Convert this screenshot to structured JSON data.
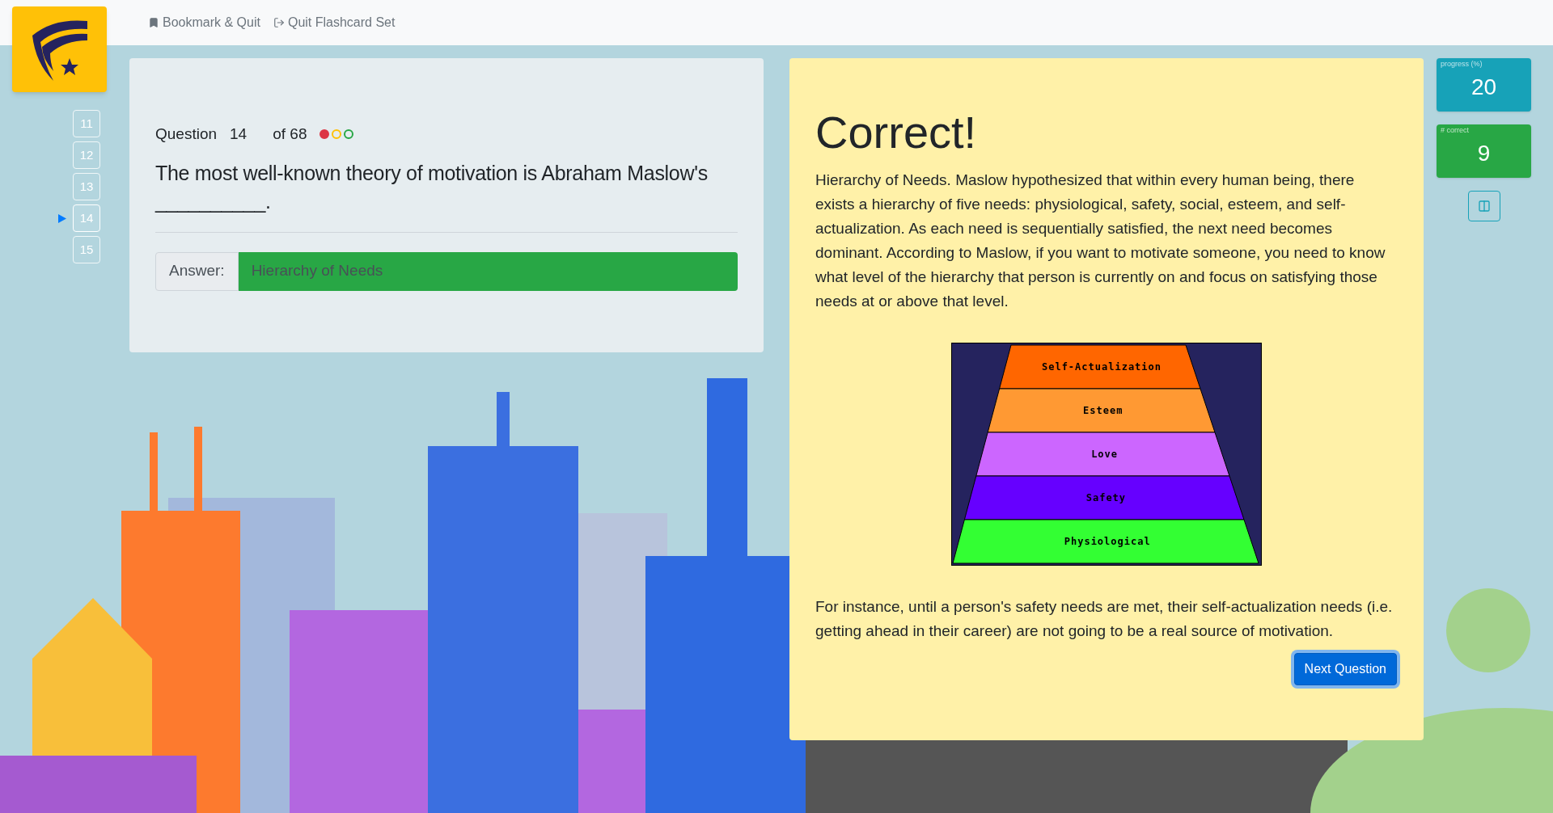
{
  "nav": {
    "links": [
      {
        "kind": "bookmark",
        "label": "Bookmark & Quit"
      },
      {
        "kind": "quit",
        "label": "Quit Flashcard Set"
      }
    ]
  },
  "question_list": [
    {
      "number": "11",
      "selected": false
    },
    {
      "number": "12",
      "selected": false
    },
    {
      "number": "13",
      "selected": false
    },
    {
      "number": "14",
      "selected": true
    },
    {
      "number": "15",
      "selected": false
    }
  ],
  "question": {
    "label": "Question",
    "number": "14",
    "total": "of 68",
    "status_marks": [
      {
        "color": "#dc3545",
        "filled": true
      },
      {
        "color": "#ffc107",
        "filled": false
      },
      {
        "color": "#28a745",
        "filled": false
      }
    ],
    "text": "The most well-known theory of motivation is Abraham Maslow's __________.",
    "answer_label": "Answer:",
    "answer_value": "Hierarchy of Needs"
  },
  "feedback": {
    "title": "Correct!",
    "paragraphs": [
      "Hierarchy of Needs. Maslow hypothesized that within every human being, there exists a hierarchy of five needs: physiological, safety, social, esteem, and self-actualization. As each need is sequentially satisfied, the next need becomes dominant. According to Maslow, if you want to motivate someone, you need to know what level of the hierarchy that person is currently on and focus on satisfying those needs at or above that level.",
      "For instance, until a person's safety needs are met, their self-actualization needs (i.e. getting ahead in their career) are not going to be a real source of motivation."
    ],
    "pyramid": [
      {
        "label": "Self-Actualization",
        "color": "#ff6600"
      },
      {
        "label": "Esteem",
        "color": "#ff9933"
      },
      {
        "label": "Love",
        "color": "#cc66ff"
      },
      {
        "label": "Safety",
        "color": "#6600ff"
      },
      {
        "label": "Physiological",
        "color": "#33ff33"
      }
    ],
    "next_button": "Next Question"
  },
  "stats": [
    {
      "label": "progress (%)",
      "value": "20",
      "color": "#17a2b8"
    },
    {
      "label": "# correct",
      "value": "9",
      "color": "#28a745"
    }
  ]
}
